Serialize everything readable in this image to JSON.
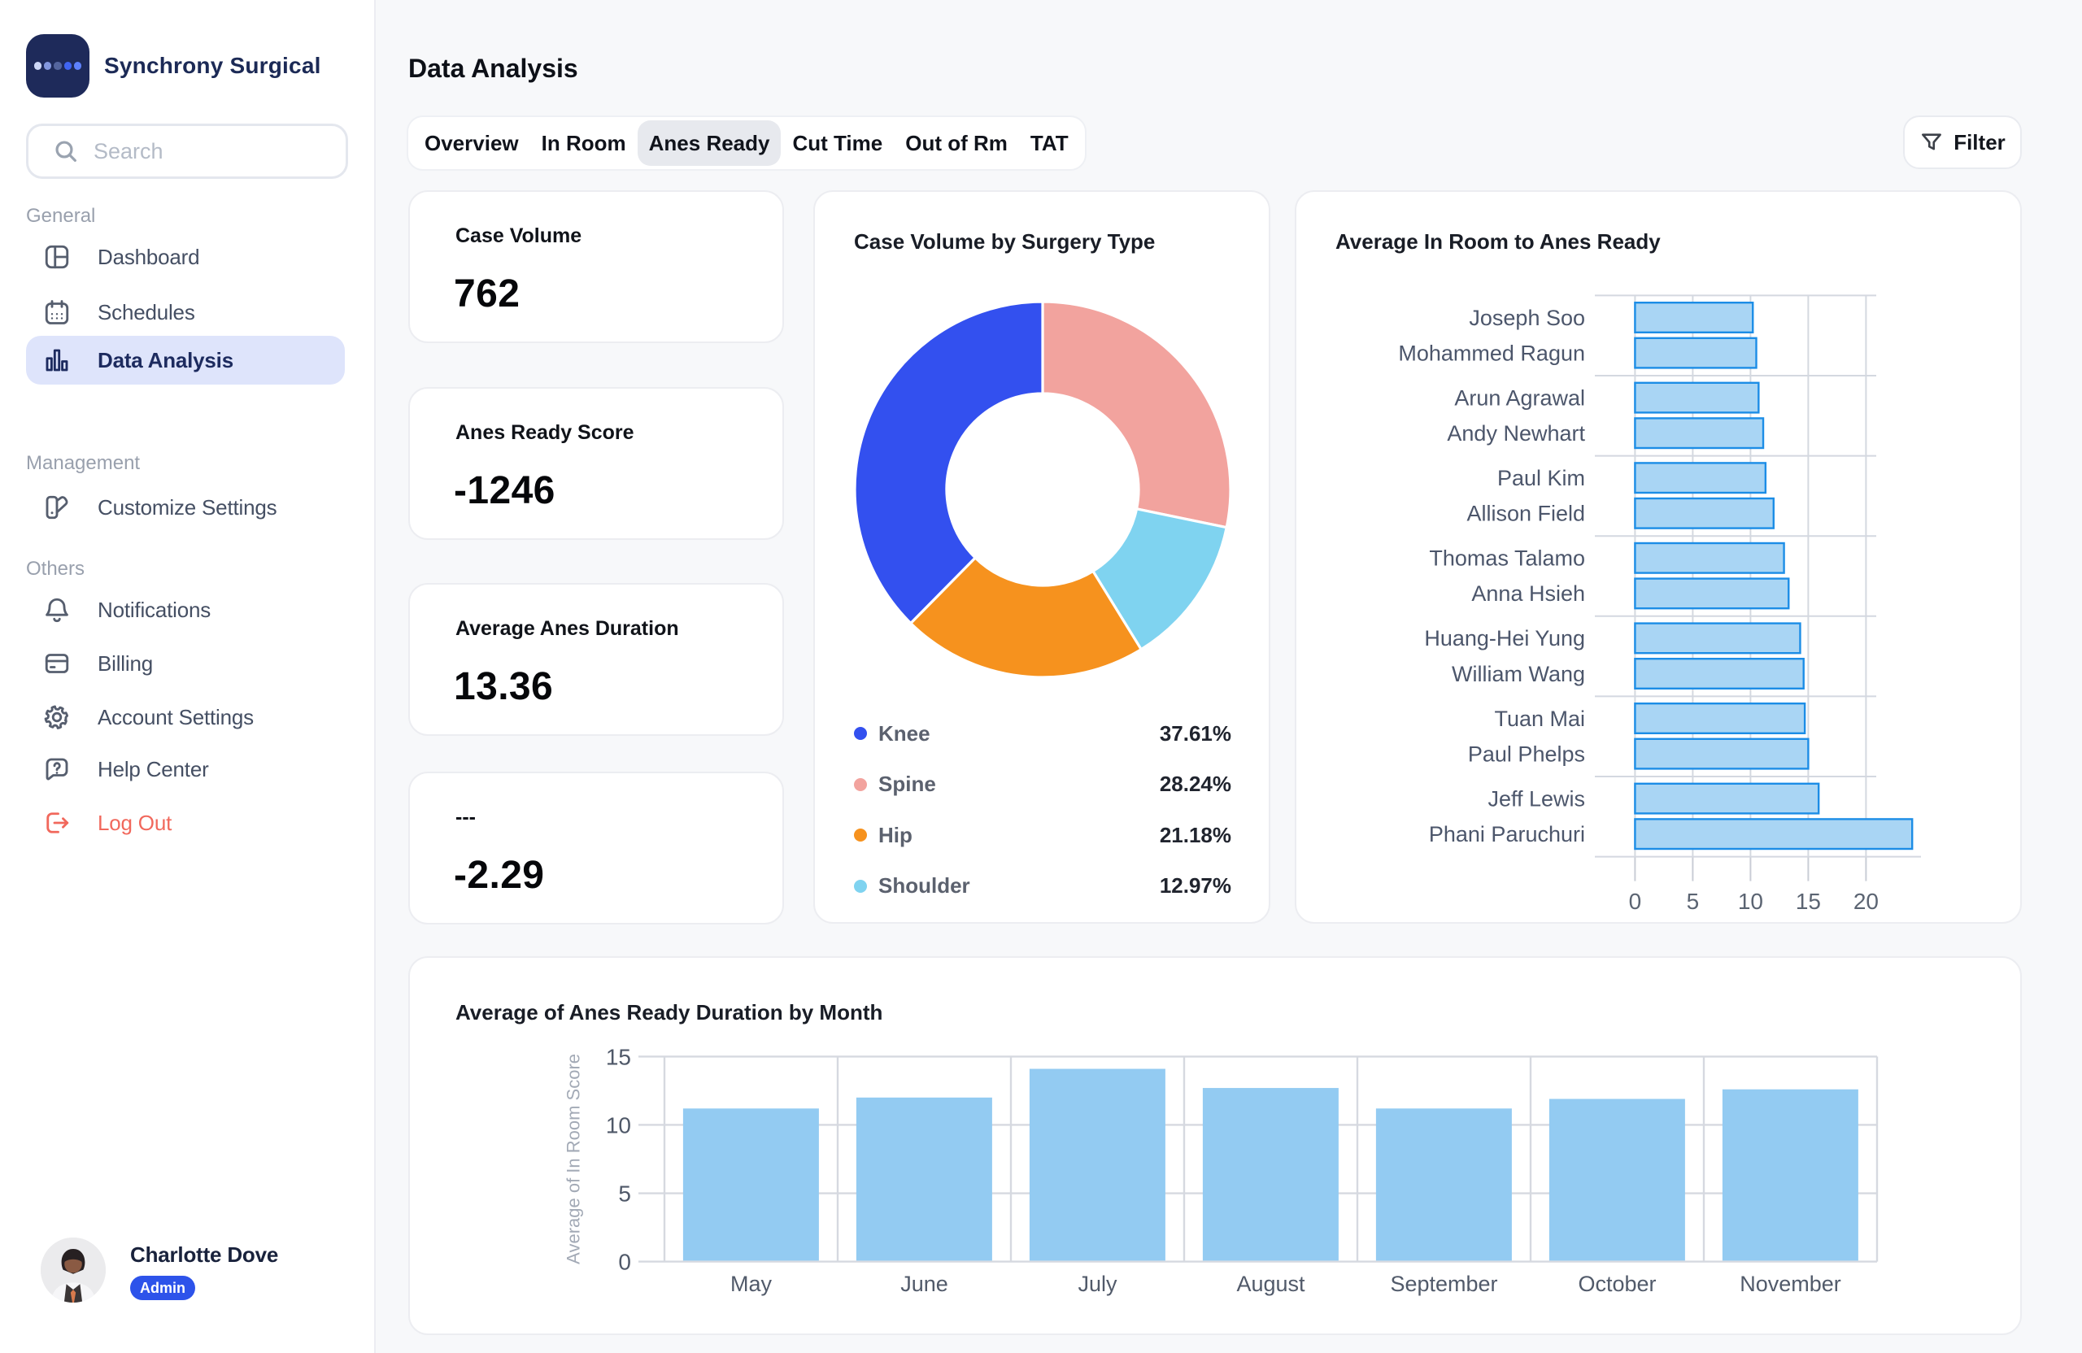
{
  "sidebar": {
    "brand": "Synchrony Surgical",
    "logo_dot_colors": [
      "#cdd7f7",
      "#8397de",
      "#54659e",
      "#4064f1",
      "#5e81fc"
    ],
    "search_placeholder": "Search",
    "sections": [
      {
        "label": "General",
        "items": [
          {
            "label": "Dashboard",
            "icon": "dashboard-icon"
          },
          {
            "label": "Schedules",
            "icon": "schedules-icon"
          },
          {
            "label": "Data Analysis",
            "icon": "data-analysis-icon",
            "active": true
          }
        ]
      },
      {
        "label": "Management",
        "items": [
          {
            "label": "Customize Settings",
            "icon": "customize-settings-icon"
          }
        ]
      },
      {
        "label": "Others",
        "items": [
          {
            "label": "Notifications",
            "icon": "notifications-icon"
          },
          {
            "label": "Billing",
            "icon": "billing-icon"
          },
          {
            "label": "Account Settings",
            "icon": "account-settings-icon"
          },
          {
            "label": "Help Center",
            "icon": "help-center-icon"
          },
          {
            "label": "Log Out",
            "icon": "log-out-icon",
            "danger": true
          }
        ]
      }
    ],
    "user": {
      "name": "Charlotte Dove",
      "role": "Admin"
    }
  },
  "header": {
    "title": "Data Analysis",
    "tabs": [
      {
        "label": "Overview"
      },
      {
        "label": "In Room"
      },
      {
        "label": "Anes Ready",
        "active": true
      },
      {
        "label": "Cut Time"
      },
      {
        "label": "Out of Rm"
      },
      {
        "label": "TAT"
      }
    ],
    "filter_label": "Filter"
  },
  "stats": [
    {
      "label": "Case Volume",
      "value": "762"
    },
    {
      "label": "Anes Ready Score",
      "value": "-1246"
    },
    {
      "label": "Average Anes Duration",
      "value": "13.36"
    },
    {
      "label": "---",
      "value": "-2.29"
    }
  ],
  "chart_data": [
    {
      "type": "pie",
      "donut": true,
      "title": "Case Volume by Surgery Type",
      "categories": [
        "Knee",
        "Spine",
        "Hip",
        "Shoulder"
      ],
      "values": [
        37.61,
        28.24,
        21.18,
        12.97
      ],
      "value_labels": [
        "37.61%",
        "28.24%",
        "21.18%",
        "12.97%"
      ],
      "colors": [
        "#3350ef",
        "#f2a39e",
        "#f6921e",
        "#7fd3f0"
      ],
      "legend_position": "bottom"
    },
    {
      "type": "bar-horizontal",
      "title": "Average In Room to Anes Ready",
      "categories": [
        "Joseph Soo",
        "Mohammed Ragun",
        "Arun Agrawal",
        "Andy Newhart",
        "Paul Kim",
        "Allison Field",
        "Thomas Talamo",
        "Anna Hsieh",
        "Huang-Hei Yung",
        "William Wang",
        "Tuan Mai",
        "Paul Phelps",
        "Jeff Lewis",
        "Phani Paruchuri"
      ],
      "values": [
        10.2,
        10.5,
        10.7,
        11.1,
        11.3,
        12.0,
        12.9,
        13.3,
        14.3,
        14.6,
        14.7,
        15.0,
        15.9,
        24.0
      ],
      "xticks": [
        0,
        5,
        10,
        15,
        20
      ],
      "xlim": [
        0,
        21
      ],
      "bar_fill": "#a9d5f4",
      "bar_stroke": "#1c8de6",
      "grid": true
    },
    {
      "type": "bar",
      "title": "Average of Anes Ready Duration by Month",
      "ylabel": "Average of In Room Score",
      "xlabel": "",
      "categories": [
        "May",
        "June",
        "July",
        "August",
        "September",
        "October",
        "November"
      ],
      "values": [
        11.2,
        12.0,
        14.1,
        12.7,
        11.2,
        11.9,
        12.6
      ],
      "yticks": [
        0,
        5,
        10,
        15
      ],
      "ylim": [
        0,
        15
      ],
      "bar_fill": "#93cbf2",
      "grid": true
    }
  ]
}
